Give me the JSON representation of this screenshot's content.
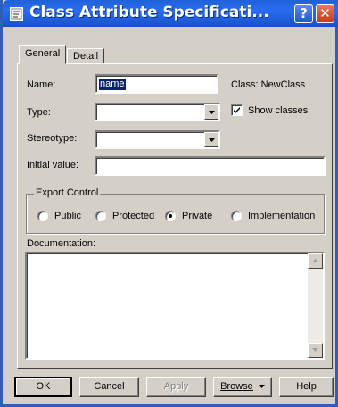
{
  "window": {
    "title": "Class Attribute Specificati...",
    "help_glyph": "?",
    "close_glyph": "✕",
    "title_icon": "class-attribute-icon"
  },
  "tabs": [
    {
      "label": "General",
      "active": true
    },
    {
      "label": "Detail",
      "active": false
    }
  ],
  "form": {
    "name_label": "Name:",
    "name_value": "name",
    "class_label": "Class:",
    "class_value": "NewClass",
    "type_label": "Type:",
    "type_value": "",
    "show_classes_label": "Show classes",
    "show_classes_checked": true,
    "stereotype_label": "Stereotype:",
    "stereotype_value": "",
    "initial_value_label": "Initial value:",
    "initial_value": ""
  },
  "export_control": {
    "title": "Export Control",
    "options": [
      "Public",
      "Protected",
      "Private",
      "Implementation"
    ],
    "selected": "Private"
  },
  "documentation": {
    "label": "Documentation:",
    "value": ""
  },
  "buttons": {
    "ok": "OK",
    "cancel": "Cancel",
    "apply": "Apply",
    "browse": "Browse",
    "help": "Help"
  },
  "colors": {
    "titlebar": "#1e62d8",
    "face": "#d4d0c8",
    "close": "#c53a18",
    "selection": "#0a246a"
  }
}
